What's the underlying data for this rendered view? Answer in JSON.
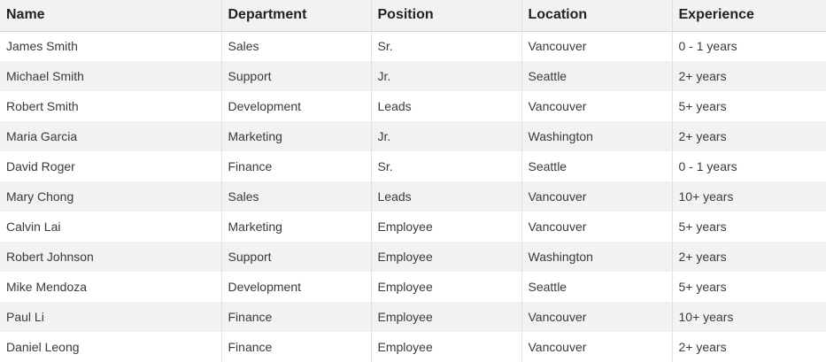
{
  "table": {
    "headers": [
      "Name",
      "Department",
      "Position",
      "Location",
      "Experience"
    ],
    "rows": [
      [
        "James Smith",
        "Sales",
        "Sr.",
        "Vancouver",
        "0 - 1 years"
      ],
      [
        "Michael Smith",
        "Support",
        "Jr.",
        "Seattle",
        "2+ years"
      ],
      [
        "Robert Smith",
        "Development",
        "Leads",
        "Vancouver",
        "5+ years"
      ],
      [
        "Maria Garcia",
        "Marketing",
        "Jr.",
        "Washington",
        "2+ years"
      ],
      [
        "David Roger",
        "Finance",
        "Sr.",
        "Seattle",
        "0 - 1 years"
      ],
      [
        "Mary Chong",
        "Sales",
        "Leads",
        "Vancouver",
        "10+ years"
      ],
      [
        "Calvin Lai",
        "Marketing",
        "Employee",
        "Vancouver",
        "5+ years"
      ],
      [
        "Robert Johnson",
        "Support",
        "Employee",
        "Washington",
        "2+ years"
      ],
      [
        "Mike Mendoza",
        "Development",
        "Employee",
        "Seattle",
        "5+ years"
      ],
      [
        "Paul Li",
        "Finance",
        "Employee",
        "Vancouver",
        "10+ years"
      ],
      [
        "Daniel Leong",
        "Finance",
        "Employee",
        "Vancouver",
        "2+ years"
      ]
    ]
  },
  "colors": {
    "header_background": "#f2f2f2",
    "stripe_background": "#f2f2f2",
    "row_background": "#ffffff"
  }
}
